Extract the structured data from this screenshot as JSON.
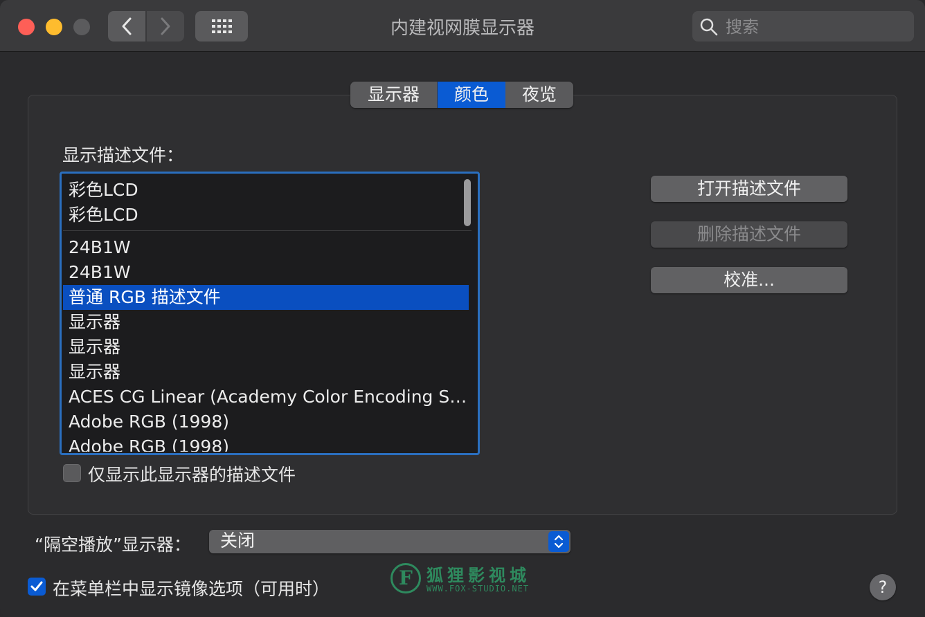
{
  "window": {
    "title": "内建视网膜显示器",
    "search_placeholder": "搜索"
  },
  "tabs": [
    {
      "label": "显示器",
      "selected": false
    },
    {
      "label": "颜色",
      "selected": true
    },
    {
      "label": "夜览",
      "selected": false
    }
  ],
  "color": {
    "profiles_label": "显示描述文件：",
    "profiles_top": [
      "彩色LCD",
      "彩色LCD"
    ],
    "profiles": [
      "24B1W",
      "24B1W",
      "普通 RGB 描述文件",
      "显示器",
      "显示器",
      "显示器",
      "ACES CG Linear (Academy Color Encoding System AP1)",
      "Adobe RGB (1998)",
      "Adobe RGB (1998)"
    ],
    "selected_profile": "普通 RGB 描述文件",
    "open_profile_button": "打开描述文件",
    "delete_profile_button": "删除描述文件",
    "calibrate_button": "校准...",
    "only_this_display_label": "仅显示此显示器的描述文件",
    "only_this_display_checked": false
  },
  "airplay": {
    "label": "“隔空播放”显示器：",
    "value": "关闭"
  },
  "menu_bar": {
    "label": "在菜单栏中显示镜像选项（可用时）",
    "checked": true
  },
  "watermark": {
    "letter": "F",
    "name": "狐狸影视城",
    "url": "WWW.FOX-STUDIO.NET"
  },
  "help_label": "?",
  "colors": {
    "accent": "#0a5bd3",
    "selection": "#0a4fc0",
    "watermark": "#2e8a5e"
  }
}
